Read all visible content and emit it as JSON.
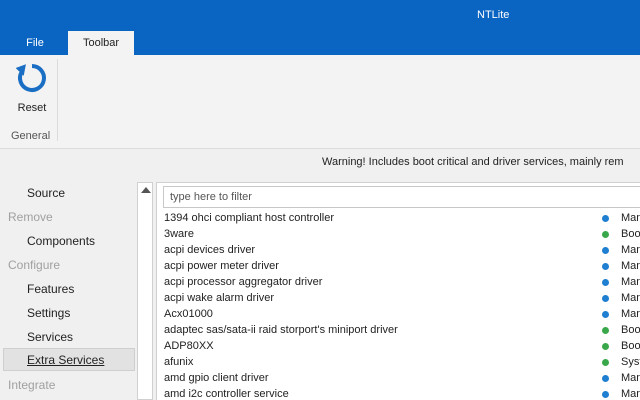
{
  "window": {
    "title": "NTLite"
  },
  "tabs": {
    "file": "File",
    "toolbar": "Toolbar"
  },
  "ribbon": {
    "reset_label": "Reset",
    "group_label": "General",
    "icon": "refresh-icon"
  },
  "warning": "Warning! Includes boot critical and driver services, mainly rem",
  "sidebar": {
    "source": "Source",
    "remove": "Remove",
    "components": "Components",
    "configure": "Configure",
    "features": "Features",
    "settings": "Settings",
    "services": "Services",
    "extra_services": "Extra Services",
    "integrate": "Integrate"
  },
  "filter": {
    "placeholder": "type here to filter",
    "value": ""
  },
  "colors": {
    "manual": "#1f7fd0",
    "boot": "#3aa84a",
    "system": "#3aa84a",
    "accent": "#0a64c2"
  },
  "services": [
    {
      "name": "1394 ohci compliant host controller",
      "start": "Man",
      "status": "manual"
    },
    {
      "name": "3ware",
      "start": "Boo",
      "status": "boot"
    },
    {
      "name": "acpi devices driver",
      "start": "Man",
      "status": "manual"
    },
    {
      "name": "acpi power meter driver",
      "start": "Man",
      "status": "manual"
    },
    {
      "name": "acpi processor aggregator driver",
      "start": "Man",
      "status": "manual"
    },
    {
      "name": "acpi wake alarm driver",
      "start": "Man",
      "status": "manual"
    },
    {
      "name": "Acx01000",
      "start": "Man",
      "status": "manual"
    },
    {
      "name": "adaptec sas/sata-ii raid storport's miniport driver",
      "start": "Boo",
      "status": "boot"
    },
    {
      "name": "ADP80XX",
      "start": "Boo",
      "status": "boot"
    },
    {
      "name": "afunix",
      "start": "Syst",
      "status": "system"
    },
    {
      "name": "amd gpio client driver",
      "start": "Man",
      "status": "manual"
    },
    {
      "name": "amd i2c controller service",
      "start": "Man",
      "status": "manual"
    }
  ]
}
